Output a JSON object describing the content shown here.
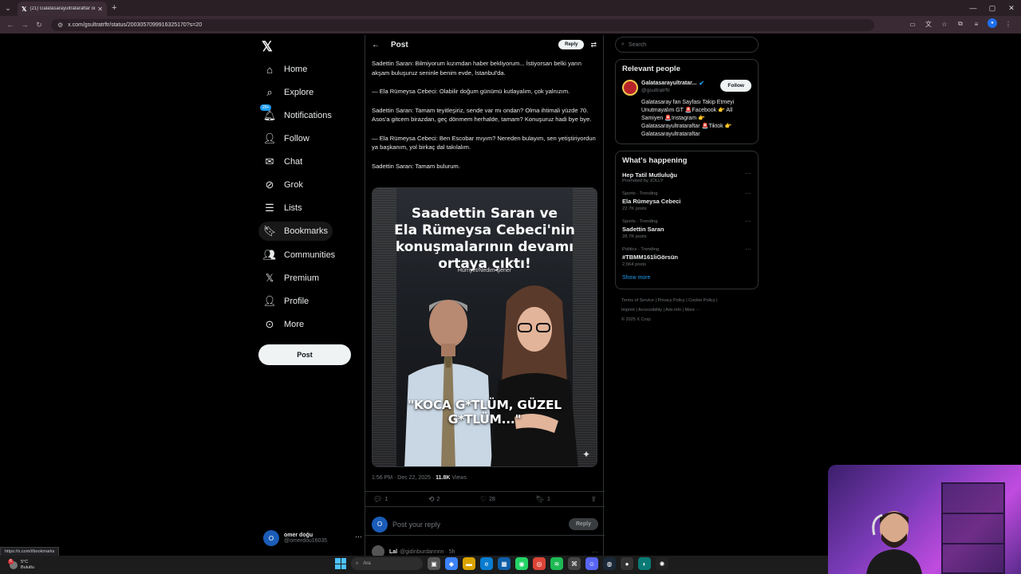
{
  "browser": {
    "tab_title": "(21) Galatasarayultrataraftar on X",
    "url": "x.com/gsultratrftr/status/2003057099916325170?s=20",
    "status_url": "https://x.com/i/bookmarks"
  },
  "nav": {
    "items": [
      {
        "label": "Home",
        "icon": "home-icon"
      },
      {
        "label": "Explore",
        "icon": "search-icon"
      },
      {
        "label": "Notifications",
        "icon": "bell-icon",
        "badge": "20+"
      },
      {
        "label": "Follow",
        "icon": "person-add-icon"
      },
      {
        "label": "Chat",
        "icon": "mail-icon"
      },
      {
        "label": "Grok",
        "icon": "grok-icon"
      },
      {
        "label": "Lists",
        "icon": "list-icon"
      },
      {
        "label": "Bookmarks",
        "icon": "bookmark-icon"
      },
      {
        "label": "Communities",
        "icon": "people-icon"
      },
      {
        "label": "Premium",
        "icon": "x-icon"
      },
      {
        "label": "Profile",
        "icon": "person-icon"
      },
      {
        "label": "More",
        "icon": "more-circle-icon"
      }
    ],
    "post_button": "Post",
    "account": {
      "initial": "O",
      "name": "omer doğu",
      "handle": "@omerdou16035"
    }
  },
  "post": {
    "header_title": "Post",
    "reply_button": "Reply",
    "paragraphs": [
      "Sadettin Saran: Bilmiyorum kızımdan haber bekliyorum... İstiyorsan belki yarın akşam buluşuruz seninle benim evde, İstanbul'da.",
      "— Ela Rümeysa Cebeci: Olabilir doğum günümü kutlayalım, çok yalnızım.",
      "Sadettin Saran: Tamam teyitleşiriz, sende var mı ondan? Olma ihtimali yüzde 70. Asos'a gitcem birazdan, geç dönmem herhalde, tamam? Konuşuruz hadi bye bye.",
      "— Ela Rümeysa Cebeci: Ben Escobar mıyım? Nereden bulayım, sen yetiştiriyordun ya başkanım, yol birkaç dal takılalım.",
      "Sadettin Saran: Tamam bulurum."
    ],
    "media": {
      "headline_lines": [
        "Saadettin Saran ve",
        "Ela Rümeysa Cebeci'nin",
        "konuşmalarının devamı",
        "ortaya çıktı!"
      ],
      "credit": "Hürriyet/Nedim Şener",
      "quote": "\"KOCA G*TLÜM, GÜZEL G*TLÜM...\""
    },
    "timestamp": "1:56 PM · Dec 22, 2025 · ",
    "views": "11.8K",
    "views_label": " Views",
    "actions": {
      "replies": "1",
      "reposts": "2",
      "likes": "28",
      "bookmarks": "1"
    },
    "reply_placeholder": "Post your reply",
    "reply_avatar": "O",
    "reply_submit": "Reply",
    "next_reply": {
      "name": "Lal",
      "handle": "@gidinburdannnn · 5h"
    }
  },
  "sidebar": {
    "search_placeholder": "Search",
    "relevant_title": "Relevant people",
    "person": {
      "name": "Galatasarayultratar...",
      "handle": "@gsultratrftr",
      "follow": "Follow",
      "bio": "Galatasaray fan Sayfası Takip Etmeyi Unutmayalım GT 🚨Facebook 👉 All Samiyen 🚨Instagram 👉 Galatasarayultrataraftar 🚨Tiktok 👉 Galatasarayultrataraftar"
    },
    "happening_title": "What's happening",
    "trends": [
      {
        "context": "Promoted by JOLLY",
        "name": "Hep Tatil Mutluluğu",
        "count": ""
      },
      {
        "context": "Sports · Trending",
        "name": "Ela Rümeysa Cebeci",
        "count": "22.7K posts"
      },
      {
        "context": "Sports · Trending",
        "name": "Sadettin Saran",
        "count": "28.7K posts"
      },
      {
        "context": "Politics · Trending",
        "name": "#TBMM161liGörsün",
        "count": "2,564 posts"
      }
    ],
    "show_more": "Show more",
    "footer_line1": "Terms of Service  |  Privacy Policy  |  Cookie Policy  |",
    "footer_line2": "Imprint  |  Accessibility  |  Ads info  |  More ···",
    "footer_line3": "© 2025 X Corp."
  },
  "taskbar": {
    "temp": "5°C",
    "weather": "Bulutlu",
    "weather_badge": "6",
    "search": "Ara"
  }
}
